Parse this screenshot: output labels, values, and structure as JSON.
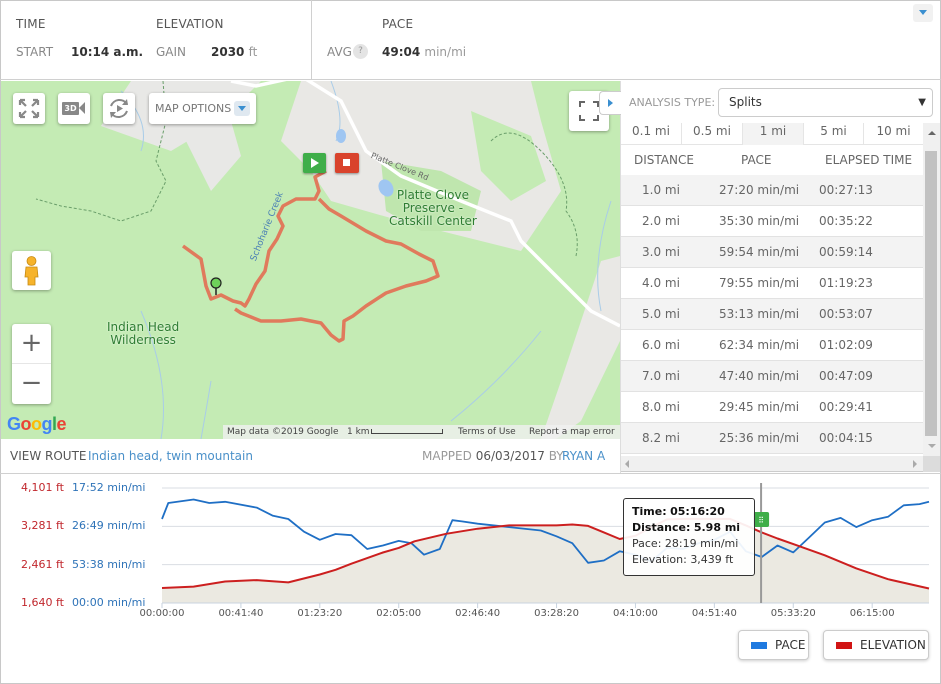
{
  "header": {
    "time": {
      "title": "TIME",
      "label": "START",
      "value": "10:14 a.m."
    },
    "elevation": {
      "title": "ELEVATION",
      "label": "GAIN",
      "value": "2030",
      "unit": "ft"
    },
    "pace": {
      "title": "PACE",
      "label": "AVG",
      "help": "?",
      "value": "49:04",
      "unit": "min/mi"
    },
    "collapse_icon": "chevron-down-icon"
  },
  "map": {
    "controls": {
      "fullscreen_icon": "expand-arrows-icon",
      "view3d_label": "3D",
      "replay_icon": "replay-icon",
      "options_label": "MAP OPTIONS",
      "zoom_in": "+",
      "zoom_out": "−",
      "pegman_icon": "street-view-pegman-icon",
      "full_extent_icon": "fullscreen-corners-icon"
    },
    "labels": {
      "area1": "Indian Head",
      "area1b": "Wilderness",
      "area2": "Platte Clove",
      "area2b": "Preserve -",
      "area2c": "Catskill Center",
      "road": "Platte Clove Rd",
      "creek": "Schoharie Creek"
    },
    "footer": {
      "data": "Map data ©2019 Google",
      "scale": "1 km",
      "terms": "Terms of Use",
      "report": "Report a map error"
    },
    "logo": [
      "G",
      "o",
      "o",
      "g",
      "l",
      "e"
    ],
    "logo_colors": [
      "#4285F4",
      "#EA4335",
      "#FBBC05",
      "#4285F4",
      "#34A853",
      "#EA4335"
    ],
    "route_color": "#e07a5c",
    "start_marker_color": "#3fae49",
    "end_marker_color": "#d9432c"
  },
  "route_info": {
    "view_label": "VIEW ROUTE",
    "route_name": "Indian head, twin mountain",
    "mapped_label": "MAPPED",
    "mapped_date": "06/03/2017",
    "by_label": "BY",
    "user": "RYAN A"
  },
  "analysis": {
    "type_label": "ANALYSIS TYPE:",
    "type_value": "Splits",
    "tabs": [
      {
        "label": "0.1 mi",
        "active": false
      },
      {
        "label": "0.5 mi",
        "active": false
      },
      {
        "label": "1 mi",
        "active": true
      },
      {
        "label": "5 mi",
        "active": false
      },
      {
        "label": "10 mi",
        "active": false
      }
    ],
    "columns": [
      "DISTANCE",
      "PACE",
      "ELAPSED TIME"
    ],
    "rows": [
      [
        "1.0 mi",
        "27:20 min/mi",
        "00:27:13"
      ],
      [
        "2.0 mi",
        "35:30 min/mi",
        "00:35:22"
      ],
      [
        "3.0 mi",
        "59:54 min/mi",
        "00:59:14"
      ],
      [
        "4.0 mi",
        "79:55 min/mi",
        "01:19:23"
      ],
      [
        "5.0 mi",
        "53:13 min/mi",
        "00:53:07"
      ],
      [
        "6.0 mi",
        "62:34 min/mi",
        "01:02:09"
      ],
      [
        "7.0 mi",
        "47:40 min/mi",
        "00:47:09"
      ],
      [
        "8.0 mi",
        "29:45 min/mi",
        "00:29:41"
      ],
      [
        "8.2 mi",
        "25:36 min/mi",
        "00:04:15"
      ]
    ]
  },
  "chart_data": {
    "type": "line",
    "title": "",
    "xlabel": "Elapsed time",
    "x_ticks": [
      "00:00:00",
      "00:41:40",
      "01:23:20",
      "02:05:00",
      "02:46:40",
      "03:28:20",
      "04:10:00",
      "04:51:40",
      "05:33:20",
      "06:15:00"
    ],
    "x_tick_seconds": [
      0,
      2500,
      5000,
      7500,
      10000,
      12500,
      15000,
      17500,
      20000,
      22500
    ],
    "x_range_seconds": [
      0,
      24300
    ],
    "y_left": {
      "label": "Elevation",
      "ticks": [
        "4,101 ft",
        "3,281 ft",
        "2,461 ft",
        "1,640 ft"
      ],
      "range": [
        1640,
        4101
      ]
    },
    "y_right": {
      "label": "Pace",
      "ticks": [
        "17:52 min/mi",
        "26:49 min/mi",
        "53:38 min/mi",
        "00:00 min/mi"
      ]
    },
    "grid": true,
    "series": [
      {
        "name": "ELEVATION",
        "color": "#cc1f1f",
        "x_seconds": [
          0,
          1000,
          2000,
          3000,
          4000,
          5000,
          5500,
          6000,
          7000,
          7500,
          8000,
          9000,
          10000,
          11000,
          12000,
          12500,
          13000,
          13500,
          14000,
          14500,
          15000,
          15500,
          16000,
          16500,
          17000,
          17500,
          18000,
          18500,
          19000,
          19500,
          20000,
          21000,
          22000,
          23000,
          24300
        ],
        "values": [
          1960,
          1990,
          2100,
          2130,
          2080,
          2250,
          2350,
          2480,
          2720,
          2820,
          2960,
          3120,
          3230,
          3300,
          3300,
          3300,
          3320,
          3290,
          3150,
          3010,
          3080,
          3260,
          3430,
          3440,
          3440,
          3440,
          3439,
          3300,
          3150,
          3020,
          2900,
          2660,
          2380,
          2150,
          1950
        ]
      },
      {
        "name": "PACE",
        "color": "#1f6fc5",
        "x_seconds": [
          0,
          200,
          1000,
          1500,
          2000,
          3000,
          3500,
          4000,
          4500,
          5000,
          5500,
          6000,
          6500,
          7000,
          7500,
          7900,
          8300,
          8800,
          9200,
          9500,
          10000,
          11000,
          12000,
          12500,
          13000,
          13500,
          14000,
          14500,
          15000,
          15500,
          16000,
          16500,
          17000,
          17500,
          18000,
          18500,
          19000,
          19500,
          20000,
          20500,
          21000,
          21500,
          22000,
          22500,
          23000,
          23500,
          24000,
          24300
        ],
        "pace_axis_fraction": [
          0.73,
          0.87,
          0.9,
          0.87,
          0.88,
          0.83,
          0.76,
          0.73,
          0.62,
          0.55,
          0.6,
          0.59,
          0.47,
          0.5,
          0.54,
          0.52,
          0.42,
          0.47,
          0.72,
          0.71,
          0.69,
          0.66,
          0.63,
          0.58,
          0.52,
          0.35,
          0.37,
          0.45,
          0.42,
          0.36,
          0.48,
          0.47,
          0.52,
          0.55,
          0.62,
          0.45,
          0.4,
          0.5,
          0.44,
          0.57,
          0.7,
          0.74,
          0.66,
          0.72,
          0.75,
          0.85,
          0.86,
          0.88
        ]
      }
    ],
    "cursor": {
      "time": "05:16:20",
      "seconds": 18980
    },
    "tooltip": {
      "time_label": "Time:",
      "time": "05:16:20",
      "distance_label": "Distance:",
      "distance": "5.98 mi",
      "pace_label": "Pace:",
      "pace": "28:19 min/mi",
      "elevation_label": "Elevation:",
      "elevation": "3,439 ft"
    },
    "legend": [
      {
        "name": "PACE",
        "color": "#1f7ae0"
      },
      {
        "name": "ELEVATION",
        "color": "#d11414"
      }
    ]
  }
}
